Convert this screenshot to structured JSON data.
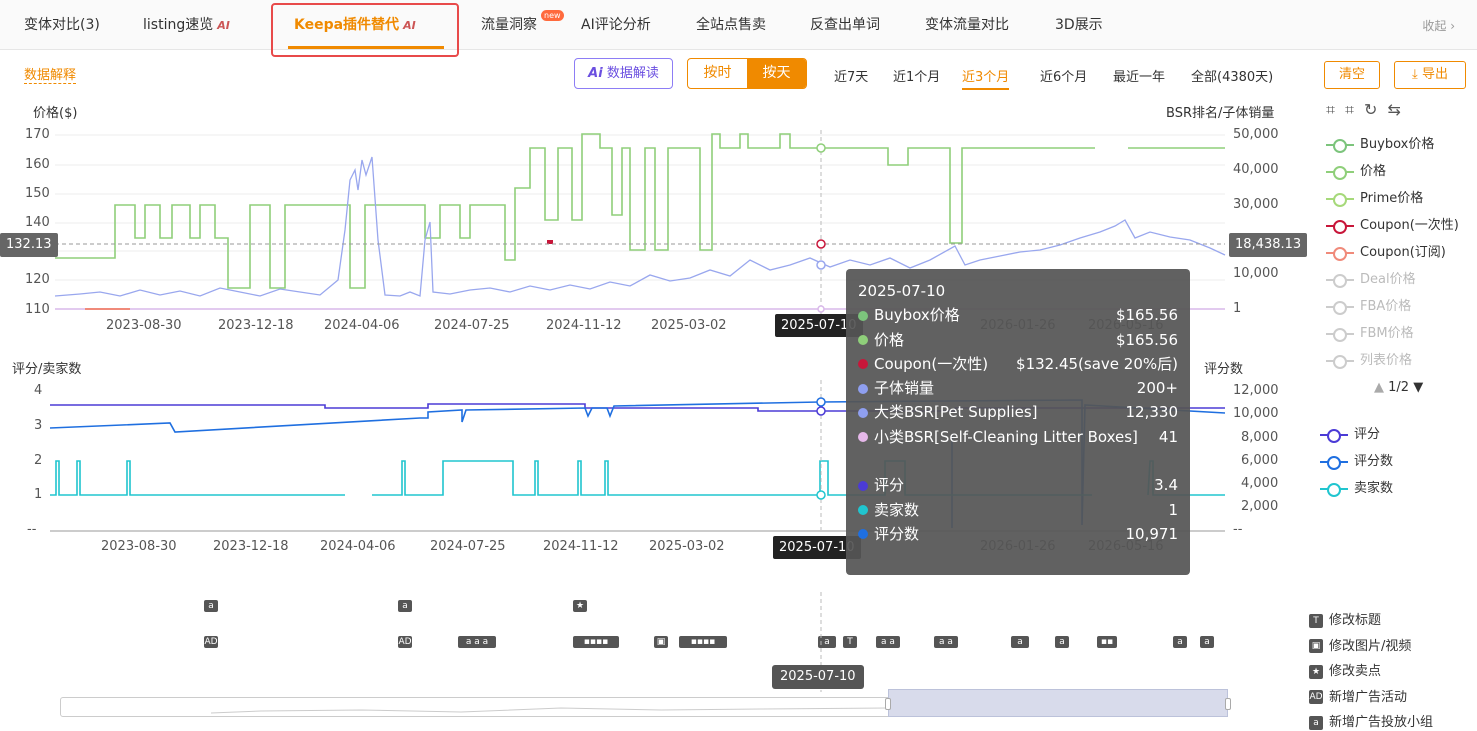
{
  "tabs": [
    {
      "label": "变体对比(3)"
    },
    {
      "label": "listing速览",
      "ai": "AI"
    },
    {
      "label": "Keepa插件替代",
      "ai": "AI"
    },
    {
      "label": "流量洞察",
      "badge": "new"
    },
    {
      "label": "AI评论分析"
    },
    {
      "label": "全站点售卖"
    },
    {
      "label": "反查出单词"
    },
    {
      "label": "变体流量对比"
    },
    {
      "label": "3D展示"
    }
  ],
  "collapse_label": "收起",
  "toolbar": {
    "data_explain": "数据解释",
    "ai_button": "数据解读",
    "ai_prefix": "Ai",
    "granularity": [
      "按时",
      "按天"
    ],
    "ranges": [
      "近7天",
      "近1个月",
      "近3个月",
      "近6个月",
      "最近一年",
      "全部(4380天)"
    ],
    "selected_range": "近3个月",
    "clear_label": "清空",
    "export_label": "导出"
  },
  "chart1": {
    "left_axis_title": "价格($)",
    "right_axis_title": "BSR排名/子体销量",
    "left_ticks": [
      "170",
      "160",
      "150",
      "140",
      "130",
      "120",
      "110"
    ],
    "right_ticks": [
      "50,000",
      "40,000",
      "30,000",
      "20,000",
      "10,000",
      "1"
    ],
    "x_ticks": [
      "2023-08-30",
      "2023-12-18",
      "2024-04-06",
      "2024-07-25",
      "2024-11-12",
      "2025-03-02",
      "2025-06-21",
      "2025-10-08",
      "2026-01-26",
      "2026-05-16"
    ],
    "crosshair_left": "132.13",
    "crosshair_right": "18,438.13",
    "crosshair_date": "2025-07-10"
  },
  "chart2": {
    "left_axis_title": "评分/卖家数",
    "right_axis_title": "评分数",
    "left_ticks": [
      "4",
      "3",
      "2",
      "1",
      "--"
    ],
    "right_ticks": [
      "12,000",
      "10,000",
      "8,000",
      "6,000",
      "4,000",
      "2,000",
      "--"
    ],
    "x_ticks": [
      "2023-08-30",
      "2023-12-18",
      "2024-04-06",
      "2024-07-25",
      "2024-11-12",
      "2025-03-02",
      "2025-06-21",
      "2025-10-08",
      "2026-01-26",
      "2026-05-16"
    ],
    "crosshair_date": "2025-07-10"
  },
  "legend1": [
    {
      "label": "Buybox价格",
      "color": "#7cc47c",
      "dim": false
    },
    {
      "label": "价格",
      "color": "#8fcf7a",
      "dim": false
    },
    {
      "label": "Prime价格",
      "color": "#a6d97a",
      "dim": false
    },
    {
      "label": "Coupon(一次性)",
      "color": "#c8163a",
      "dim": false
    },
    {
      "label": "Coupon(订阅)",
      "color": "#f08a7a",
      "dim": false
    },
    {
      "label": "Deal价格",
      "color": "#cccccc",
      "dim": true
    },
    {
      "label": "FBA价格",
      "color": "#cccccc",
      "dim": true
    },
    {
      "label": "FBM价格",
      "color": "#cccccc",
      "dim": true
    },
    {
      "label": "列表价格",
      "color": "#cccccc",
      "dim": true
    }
  ],
  "legend_pager": "1/2",
  "legend2": [
    {
      "label": "评分",
      "color": "#4b3bd6"
    },
    {
      "label": "评分数",
      "color": "#1f6fe0"
    },
    {
      "label": "卖家数",
      "color": "#20c5cf"
    }
  ],
  "tooltip": {
    "date": "2025-07-10",
    "rows": [
      {
        "label": "Buybox价格",
        "value": "$165.56",
        "color": "#7cc47c"
      },
      {
        "label": "价格",
        "value": "$165.56",
        "color": "#8fcf7a"
      },
      {
        "label": "Coupon(一次性)",
        "value": "$132.45(save 20%后)",
        "color": "#c8163a"
      },
      {
        "label": "子体销量",
        "value": "200+",
        "color": "#8f9ff0"
      },
      {
        "label": "大类BSR[Pet Supplies]",
        "value": "12,330",
        "color": "#8f9ff0"
      },
      {
        "label": "小类BSR[Self-Cleaning Litter Boxes]",
        "value": "41",
        "color": "#e6b8ea"
      },
      {
        "label": "",
        "value": "",
        "color": "transparent"
      },
      {
        "label": "评分",
        "value": "3.4",
        "color": "#4b3bd6"
      },
      {
        "label": "卖家数",
        "value": "1",
        "color": "#20c5cf"
      },
      {
        "label": "评分数",
        "value": "10,971",
        "color": "#1f6fe0"
      }
    ]
  },
  "event_legend": [
    {
      "icon": "T",
      "label": "修改标题"
    },
    {
      "icon": "▣",
      "label": "修改图片/视频"
    },
    {
      "icon": "★",
      "label": "修改卖点"
    },
    {
      "icon": "AD",
      "label": "新增广告活动"
    },
    {
      "icon": "a",
      "label": "新增广告投放小组"
    }
  ],
  "slider_date": "2025-07-10"
}
